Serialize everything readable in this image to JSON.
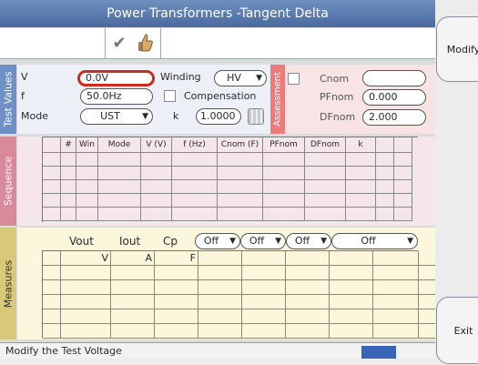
{
  "window": {
    "title": "Power Transformers -Tangent Delta"
  },
  "side_tabs": {
    "test_values": "Test Values",
    "sequence": "Sequence",
    "measures": "Measures",
    "assessment": "Assessment"
  },
  "test_values": {
    "v_label": "V",
    "v_value": "0.0V",
    "f_label": "f",
    "f_value": "50.0Hz",
    "mode_label": "Mode",
    "mode_value": "UST",
    "winding_label": "Winding",
    "winding_value": "HV",
    "compensation_label": "Compensation",
    "k_label": "k",
    "k_value": "1.0000"
  },
  "assessment": {
    "cnom_label": "Cnom",
    "cnom_value": "",
    "pfnom_label": "PFnom",
    "pfnom_value": "0.000",
    "dfnom_label": "DFnom",
    "dfnom_value": "2.000"
  },
  "sequence": {
    "headers": [
      "#",
      "Win",
      "Mode",
      "V (V)",
      "f (Hz)",
      "Cnom (F)",
      "PFnom",
      "DFnom",
      "k"
    ]
  },
  "measures": {
    "vout_label": "Vout",
    "iout_label": "Iout",
    "cp_label": "Cp",
    "filters": [
      "Off",
      "Off",
      "Off",
      "Off"
    ],
    "units": [
      "V",
      "A",
      "F"
    ]
  },
  "status": {
    "text": "Modify the Test Voltage"
  },
  "buttons": {
    "modify": "Modify",
    "exit": "Exit"
  },
  "colors": {
    "title_bar": "#4a6aa0",
    "test_values_tab": "#6f8fc7",
    "sequence_tab": "#d98a9a",
    "measures_tab": "#d9c878",
    "assessment_tab": "#ee7b7b",
    "selected_border": "#cc2a1a",
    "status_box": "#3a64b8"
  }
}
